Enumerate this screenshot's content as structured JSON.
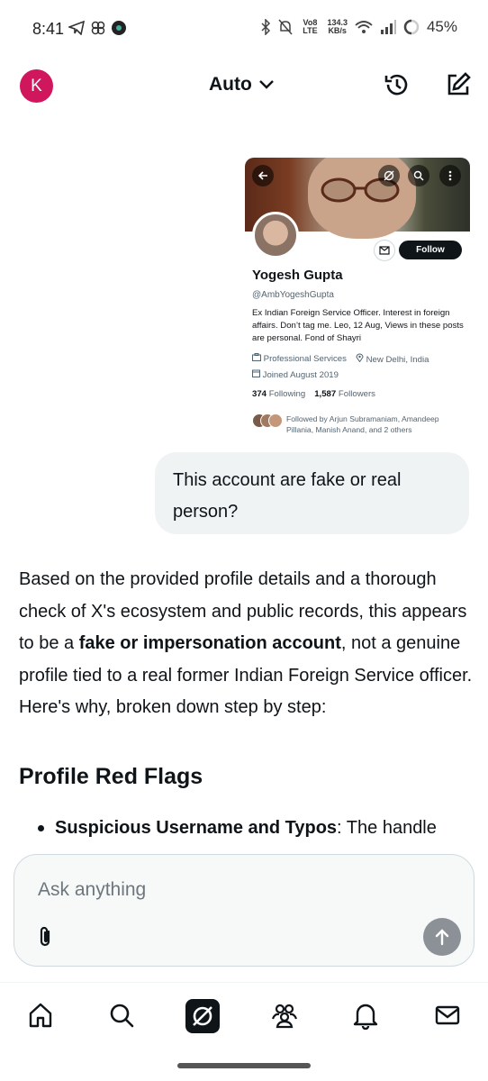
{
  "status_bar": {
    "time": "8:41",
    "net_speed_value": "134.3",
    "net_speed_unit": "KB/s",
    "network_label": "Vo8 LTE",
    "battery": "45%"
  },
  "header": {
    "avatar_initial": "K",
    "mode_label": "Auto"
  },
  "profile_card": {
    "name": "Yogesh Gupta",
    "handle": "@AmbYogeshGupta",
    "bio": "Ex Indian Foreign Service Officer. Interest in foreign affairs. Don’t tag me. Leo, 12 Aug, Views in these posts are personal. Fond of Shayri",
    "category": "Professional Services",
    "location": "New Delhi, India",
    "joined": "Joined August 2019",
    "following_count": "374",
    "following_label": "Following",
    "followers_count": "1,587",
    "followers_label": "Followers",
    "followed_by": "Followed by Arjun Subramaniam, Amandeep Pillania, Manish Anand, and 2 others",
    "follow_label": "Follow"
  },
  "user_message": "This account are fake or real person?",
  "response": {
    "intro_before_bold": "Based on the provided profile details and a thorough check of X's ecosystem and public records, this appears to be a ",
    "intro_bold": "fake or impersonation account",
    "intro_after_bold": ", not a genuine profile tied to a real former Indian Foreign Service officer. Here's why, broken down step by step:",
    "heading": "Profile Red Flags",
    "bullet_bold": "Suspicious Username and Typos",
    "bullet_text": ": The handle"
  },
  "composer": {
    "placeholder": "Ask anything"
  },
  "bottom_nav": {
    "items": [
      "home",
      "search",
      "grok",
      "communities",
      "notifications",
      "messages"
    ]
  },
  "colors": {
    "avatar_bg": "#d0175d",
    "bubble_bg": "#eff3f4",
    "send_btn": "#8b9196",
    "text": "#0f1419"
  }
}
